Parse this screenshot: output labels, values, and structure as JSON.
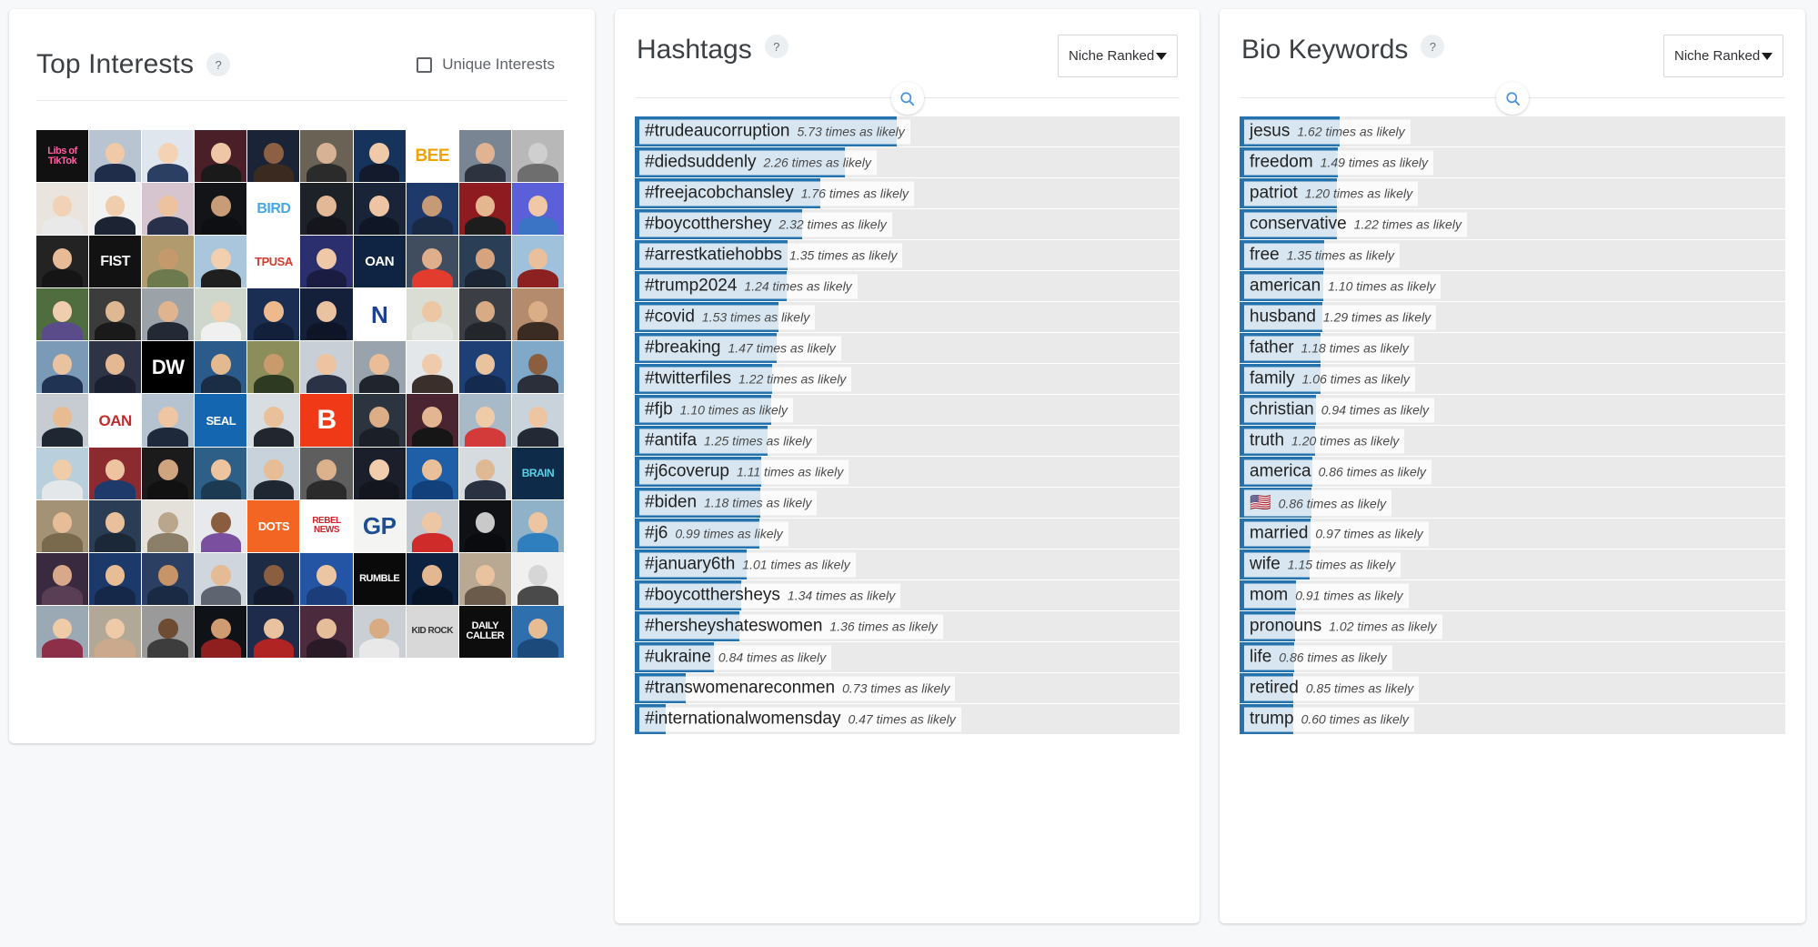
{
  "theme": {
    "bar_color": "#2573ae",
    "track_color": "#eaeaea",
    "page_bg": "#f7f8fa",
    "accent": "#4a90d9"
  },
  "interests_panel": {
    "title": "Top Interests",
    "help_label": "?",
    "checkbox_label": "Unique Interests",
    "checkbox_checked": false,
    "grid_rows": 10,
    "grid_cols": 10,
    "grid_tiles": [
      {
        "kind": "logo",
        "text": "Libs of TikTok",
        "bg": "#111111",
        "fg": "#ff5fa2",
        "fs": 11
      },
      {
        "kind": "photo",
        "bg": "#b9c4d2",
        "skin": "#f0c9a8",
        "suit": "#1f2d4a"
      },
      {
        "kind": "photo",
        "bg": "#dfe6ee",
        "skin": "#f3d3b3",
        "suit": "#2b3f63"
      },
      {
        "kind": "photo",
        "bg": "#4a1f28",
        "skin": "#efc6a6",
        "suit": "#1a1a1a"
      },
      {
        "kind": "photo",
        "bg": "#1b2436",
        "skin": "#8d5f43",
        "suit": "#3a2a20"
      },
      {
        "kind": "photo",
        "bg": "#6b6256",
        "skin": "#d8b294",
        "suit": "#2b2b2b"
      },
      {
        "kind": "photo",
        "bg": "#16335c",
        "skin": "#f0c9a8",
        "suit": "#121a2b"
      },
      {
        "kind": "logo",
        "text": "BEE",
        "bg": "#ffffff",
        "fg": "#f0a202",
        "fs": 19
      },
      {
        "kind": "photo",
        "bg": "#7a8594",
        "skin": "#e2b393",
        "suit": "#2d3440"
      },
      {
        "kind": "photo",
        "bg": "#b8b8b8",
        "skin": "#cfcfcf",
        "suit": "#6e6e6e"
      },
      {
        "kind": "photo",
        "bg": "#e9e4dd",
        "skin": "#f2d2b6",
        "suit": "#e9e9e9"
      },
      {
        "kind": "photo",
        "bg": "#f2f2f2",
        "skin": "#f0cdac",
        "suit": "#1c2433"
      },
      {
        "kind": "photo",
        "bg": "#d6c5cf",
        "skin": "#edc39f",
        "suit": "#29304a"
      },
      {
        "kind": "photo",
        "bg": "#121418",
        "skin": "#c89c78",
        "suit": "#0d0f13"
      },
      {
        "kind": "logo",
        "text": "BIRD",
        "bg": "#ffffff",
        "fg": "#4aa8e0",
        "fs": 16
      },
      {
        "kind": "photo",
        "bg": "#1d2128",
        "skin": "#e3b896",
        "suit": "#14161b"
      },
      {
        "kind": "photo",
        "bg": "#1a2438",
        "skin": "#eec5a4",
        "suit": "#0f1726"
      },
      {
        "kind": "photo",
        "bg": "#1d3a6b",
        "skin": "#c79a76",
        "suit": "#1b2a44"
      },
      {
        "kind": "photo",
        "bg": "#8e1b20",
        "skin": "#e5b791",
        "suit": "#1d1d1d"
      },
      {
        "kind": "photo",
        "bg": "#5b5fd8",
        "skin": "#f0c8a6",
        "suit": "#3b74c4"
      },
      {
        "kind": "photo",
        "bg": "#232323",
        "skin": "#e7bb96",
        "suit": "#151515"
      },
      {
        "kind": "logo",
        "text": "FIST",
        "bg": "#121212",
        "fg": "#f2f2f2",
        "fs": 16
      },
      {
        "kind": "photo",
        "bg": "#b19a6d",
        "skin": "#c49a6c",
        "suit": "#6c7a4d"
      },
      {
        "kind": "photo",
        "bg": "#a9c6dd",
        "skin": "#f2cfae",
        "suit": "#1f1f1f"
      },
      {
        "kind": "logo",
        "text": "TPUSA",
        "bg": "#ffffff",
        "fg": "#cf3b2d",
        "fs": 13
      },
      {
        "kind": "photo",
        "bg": "#2b2f6e",
        "skin": "#efc8a7",
        "suit": "#1a1c42"
      },
      {
        "kind": "logo",
        "text": "OAN",
        "bg": "#0f2342",
        "fg": "#ffffff",
        "fs": 15
      },
      {
        "kind": "photo",
        "bg": "#3f4d5e",
        "skin": "#dfae8a",
        "suit": "#e23c2f"
      },
      {
        "kind": "photo",
        "bg": "#2a3f55",
        "skin": "#d5a47e",
        "suit": "#1b2533"
      },
      {
        "kind": "photo",
        "bg": "#9fc1dc",
        "skin": "#e9bf9c",
        "suit": "#8d2020"
      },
      {
        "kind": "photo",
        "bg": "#4f6d3e",
        "skin": "#f1cdb0",
        "suit": "#5a4b8a"
      },
      {
        "kind": "photo",
        "bg": "#3c3c3c",
        "skin": "#dfb893",
        "suit": "#1a1a1a"
      },
      {
        "kind": "photo",
        "bg": "#9ba2a8",
        "skin": "#e0b48f",
        "suit": "#242a35"
      },
      {
        "kind": "photo",
        "bg": "#cfd6cb",
        "skin": "#f2d0b0",
        "suit": "#f0f0f0"
      },
      {
        "kind": "photo",
        "bg": "#1a2d52",
        "skin": "#edb98d",
        "suit": "#12203c"
      },
      {
        "kind": "photo",
        "bg": "#14203a",
        "skin": "#e9c2a0",
        "suit": "#0d1526"
      },
      {
        "kind": "logo",
        "text": "N",
        "bg": "#ffffff",
        "fg": "#1d3f94",
        "fs": 26
      },
      {
        "kind": "photo",
        "bg": "#d9ddd4",
        "skin": "#edc6a3",
        "suit": "#e3e6e0"
      },
      {
        "kind": "photo",
        "bg": "#3b3f45",
        "skin": "#d9ab85",
        "suit": "#23262b"
      },
      {
        "kind": "photo",
        "bg": "#b58b6d",
        "skin": "#dcae88",
        "suit": "#3a2c22"
      },
      {
        "kind": "photo",
        "bg": "#7b9ab8",
        "skin": "#e9c3a0",
        "suit": "#203352"
      },
      {
        "kind": "photo",
        "bg": "#2e3346",
        "skin": "#e3b893",
        "suit": "#1b2030"
      },
      {
        "kind": "logo",
        "text": "DW",
        "bg": "#000000",
        "fg": "#ffffff",
        "fs": 22
      },
      {
        "kind": "photo",
        "bg": "#2b5b8a",
        "skin": "#e5b98f",
        "suit": "#1a2d45"
      },
      {
        "kind": "photo",
        "bg": "#8b8e5a",
        "skin": "#c89a6c",
        "suit": "#2f3a23"
      },
      {
        "kind": "photo",
        "bg": "#c9cfd6",
        "skin": "#eec4a0",
        "suit": "#2a3246"
      },
      {
        "kind": "photo",
        "bg": "#99a3ad",
        "skin": "#e8bd97",
        "suit": "#1f242d"
      },
      {
        "kind": "photo",
        "bg": "#e3e7ea",
        "skin": "#f0cbab",
        "suit": "#3a2f2a"
      },
      {
        "kind": "photo",
        "bg": "#1d3f76",
        "skin": "#e9c39e",
        "suit": "#142a4f"
      },
      {
        "kind": "photo",
        "bg": "#7fa8c9",
        "skin": "#8a5e3f",
        "suit": "#2a2f3a"
      },
      {
        "kind": "photo",
        "bg": "#c6ccd2",
        "skin": "#e8bb93",
        "suit": "#1f2733"
      },
      {
        "kind": "logo",
        "text": "OAN",
        "bg": "#ffffff",
        "fg": "#c22c2c",
        "fs": 17
      },
      {
        "kind": "photo",
        "bg": "#b4c3cf",
        "skin": "#eec6a4",
        "suit": "#1e2a3c"
      },
      {
        "kind": "logo",
        "text": "SEAL",
        "bg": "#1566b0",
        "fg": "#ffffff",
        "fs": 13
      },
      {
        "kind": "photo",
        "bg": "#d8dde2",
        "skin": "#e9c09a",
        "suit": "#22272f"
      },
      {
        "kind": "logo",
        "text": "B",
        "bg": "#f03a17",
        "fg": "#ffffff",
        "fs": 30
      },
      {
        "kind": "photo",
        "bg": "#2c3440",
        "skin": "#dcae87",
        "suit": "#1a1f28"
      },
      {
        "kind": "photo",
        "bg": "#4a2430",
        "skin": "#e3b590",
        "suit": "#161616"
      },
      {
        "kind": "photo",
        "bg": "#a8b9c7",
        "skin": "#f0cba8",
        "suit": "#d33a3a"
      },
      {
        "kind": "photo",
        "bg": "#c9d3dc",
        "skin": "#eec5a2",
        "suit": "#232a36"
      },
      {
        "kind": "photo",
        "bg": "#b9cfdc",
        "skin": "#f0cda9",
        "suit": "#e4e7ea"
      },
      {
        "kind": "photo",
        "bg": "#8b2b2f",
        "skin": "#eec3a0",
        "suit": "#1d3a6b"
      },
      {
        "kind": "photo",
        "bg": "#1b1b1b",
        "skin": "#cfa57f",
        "suit": "#111111"
      },
      {
        "kind": "photo",
        "bg": "#2e5f86",
        "skin": "#eec49e",
        "suit": "#1c3a52"
      },
      {
        "kind": "photo",
        "bg": "#c7d2db",
        "skin": "#e7bd96",
        "suit": "#1f2733"
      },
      {
        "kind": "photo",
        "bg": "#5e5e5e",
        "skin": "#dcb28d",
        "suit": "#2b2b2b"
      },
      {
        "kind": "photo",
        "bg": "#1a1f2b",
        "skin": "#f1cdae",
        "suit": "#14161f"
      },
      {
        "kind": "photo",
        "bg": "#1f5fa8",
        "skin": "#e9c09a",
        "suit": "#12407a"
      },
      {
        "kind": "photo",
        "bg": "#d6dbe0",
        "skin": "#dfb894",
        "suit": "#2a3140"
      },
      {
        "kind": "logo",
        "text": "BRAIN",
        "bg": "#0f2b4a",
        "fg": "#5ad1e6",
        "fs": 12
      },
      {
        "kind": "photo",
        "bg": "#a39275",
        "skin": "#e6bd97",
        "suit": "#7a6a4d"
      },
      {
        "kind": "photo",
        "bg": "#2a3d55",
        "skin": "#e9c09c",
        "suit": "#1b2838"
      },
      {
        "kind": "photo",
        "bg": "#e4e1da",
        "skin": "#b9a68c",
        "suit": "#8c7f6a"
      },
      {
        "kind": "photo",
        "bg": "#e7e9ec",
        "skin": "#8a5d3e",
        "suit": "#7b4fa0"
      },
      {
        "kind": "logo",
        "text": "DOTS",
        "bg": "#f26522",
        "fg": "#ffffff",
        "fs": 13
      },
      {
        "kind": "logo",
        "text": "REBEL NEWS",
        "bg": "#ffffff",
        "fg": "#cc2229",
        "fs": 10
      },
      {
        "kind": "logo",
        "text": "GP",
        "bg": "#f4f4f2",
        "fg": "#1d4f91",
        "fs": 26
      },
      {
        "kind": "photo",
        "bg": "#c2c9d1",
        "skin": "#edc7a4",
        "suit": "#cf2b2b"
      },
      {
        "kind": "photo",
        "bg": "#0f1115",
        "skin": "#c9c9c9",
        "suit": "#0a0b0e"
      },
      {
        "kind": "photo",
        "bg": "#8fb2c9",
        "skin": "#eec5a1",
        "suit": "#2f7fbf"
      },
      {
        "kind": "photo",
        "bg": "#3a2a3f",
        "skin": "#d7a98a",
        "suit": "#5a3e55"
      },
      {
        "kind": "photo",
        "bg": "#1b3a6b",
        "skin": "#e8bd96",
        "suit": "#15284a"
      },
      {
        "kind": "photo",
        "bg": "#2b3f63",
        "skin": "#c79468",
        "suit": "#1a2a44"
      },
      {
        "kind": "photo",
        "bg": "#cfd6dd",
        "skin": "#e4bb95",
        "suit": "#5e6570"
      },
      {
        "kind": "photo",
        "bg": "#1d2b45",
        "skin": "#8a5e3f",
        "suit": "#121a2b"
      },
      {
        "kind": "photo",
        "bg": "#2455a4",
        "skin": "#ecc5a2",
        "suit": "#1b3e7a"
      },
      {
        "kind": "logo",
        "text": "RUMBLE",
        "bg": "#0a0a0a",
        "fg": "#ffffff",
        "fs": 11
      },
      {
        "kind": "photo",
        "bg": "#0d2240",
        "skin": "#e3b891",
        "suit": "#081528"
      },
      {
        "kind": "photo",
        "bg": "#b9a892",
        "skin": "#e9c2a0",
        "suit": "#6b5b4a"
      },
      {
        "kind": "photo",
        "bg": "#f0f0f0",
        "skin": "#d6d6d6",
        "suit": "#4a4a4a"
      },
      {
        "kind": "photo",
        "bg": "#9ba9b5",
        "skin": "#f0cba8",
        "suit": "#8e2f4a"
      },
      {
        "kind": "photo",
        "bg": "#b2a897",
        "skin": "#efcaa8",
        "suit": "#caa98c"
      },
      {
        "kind": "photo",
        "bg": "#9a9a9a",
        "skin": "#6e4b33",
        "suit": "#3d3d3d"
      },
      {
        "kind": "photo",
        "bg": "#0f1216",
        "skin": "#cf9b72",
        "suit": "#8f1f1f"
      },
      {
        "kind": "photo",
        "bg": "#1e2b4a",
        "skin": "#e9c39f",
        "suit": "#b02424"
      },
      {
        "kind": "photo",
        "bg": "#4a2a3c",
        "skin": "#e6bd99",
        "suit": "#2a1a26"
      },
      {
        "kind": "photo",
        "bg": "#c9cfd4",
        "skin": "#d9ab82",
        "suit": "#e8e8e8"
      },
      {
        "kind": "logo",
        "text": "KID ROCK",
        "bg": "#d8d8d8",
        "fg": "#333333",
        "fs": 10
      },
      {
        "kind": "logo",
        "text": "DAILY CALLER",
        "bg": "#0d0d0d",
        "fg": "#ffffff",
        "fs": 11
      },
      {
        "kind": "photo",
        "bg": "#2f6fae",
        "skin": "#e8bc93",
        "suit": "#1c4a7a"
      }
    ]
  },
  "hashtags_panel": {
    "title": "Hashtags",
    "help_label": "?",
    "sort_label": "Niche Ranked",
    "search_icon": "search-icon",
    "value_suffix": "times as likely",
    "max_bar_value": 5.73,
    "items": [
      {
        "term": "#trudeaucorruption",
        "value": "5.73",
        "bar_pct": 48.0
      },
      {
        "term": "#diedsuddenly",
        "value": "2.26",
        "bar_pct": 38.5
      },
      {
        "term": "#freejacobchansley",
        "value": "1.76",
        "bar_pct": 34.0
      },
      {
        "term": "#boycotthershey",
        "value": "2.32",
        "bar_pct": 30.8
      },
      {
        "term": "#arrestkatiehobbs",
        "value": "1.35",
        "bar_pct": 28.0
      },
      {
        "term": "#trump2024",
        "value": "1.24",
        "bar_pct": 27.8
      },
      {
        "term": "#covid",
        "value": "1.53",
        "bar_pct": 26.3
      },
      {
        "term": "#breaking",
        "value": "1.47",
        "bar_pct": 26.0
      },
      {
        "term": "#twitterfiles",
        "value": "1.22",
        "bar_pct": 25.2
      },
      {
        "term": "#fjb",
        "value": "1.10",
        "bar_pct": 25.0
      },
      {
        "term": "#antifa",
        "value": "1.25",
        "bar_pct": 24.3
      },
      {
        "term": "#j6coverup",
        "value": "1.11",
        "bar_pct": 23.2
      },
      {
        "term": "#biden",
        "value": "1.18",
        "bar_pct": 23.0
      },
      {
        "term": "#j6",
        "value": "0.99",
        "bar_pct": 22.8
      },
      {
        "term": "#january6th",
        "value": "1.01",
        "bar_pct": 20.5
      },
      {
        "term": "#boycotthersheys",
        "value": "1.34",
        "bar_pct": 19.6
      },
      {
        "term": "#hersheyshateswomen",
        "value": "1.36",
        "bar_pct": 19.2
      },
      {
        "term": "#ukraine",
        "value": "0.84",
        "bar_pct": 14.5
      },
      {
        "term": "#transwomenareconmen",
        "value": "0.73",
        "bar_pct": 9.4
      },
      {
        "term": "#internationalwomensday",
        "value": "0.47",
        "bar_pct": 5.6
      }
    ]
  },
  "bio_panel": {
    "title": "Bio Keywords",
    "help_label": "?",
    "sort_label": "Niche Ranked",
    "search_icon": "search-icon",
    "value_suffix": "times as likely",
    "max_bar_value": 1.62,
    "items": [
      {
        "term": "jesus",
        "value": "1.62",
        "bar_pct": 18.4
      },
      {
        "term": "freedom",
        "value": "1.49",
        "bar_pct": 18.0
      },
      {
        "term": "patriot",
        "value": "1.20",
        "bar_pct": 17.9
      },
      {
        "term": "conservative",
        "value": "1.22",
        "bar_pct": 17.8
      },
      {
        "term": "free",
        "value": "1.35",
        "bar_pct": 15.5
      },
      {
        "term": "american",
        "value": "1.10",
        "bar_pct": 15.4
      },
      {
        "term": "husband",
        "value": "1.29",
        "bar_pct": 15.2
      },
      {
        "term": "father",
        "value": "1.18",
        "bar_pct": 14.8
      },
      {
        "term": "family",
        "value": "1.06",
        "bar_pct": 14.8
      },
      {
        "term": "christian",
        "value": "0.94",
        "bar_pct": 14.0
      },
      {
        "term": "truth",
        "value": "1.20",
        "bar_pct": 13.8
      },
      {
        "term": "america",
        "value": "0.86",
        "bar_pct": 13.4
      },
      {
        "term": "🇺🇸",
        "value": "0.86",
        "bar_pct": 13.2,
        "is_emoji": true
      },
      {
        "term": "married",
        "value": "0.97",
        "bar_pct": 13.0
      },
      {
        "term": "wife",
        "value": "1.15",
        "bar_pct": 12.8
      },
      {
        "term": "mom",
        "value": "0.91",
        "bar_pct": 10.4
      },
      {
        "term": "pronouns",
        "value": "1.02",
        "bar_pct": 10.2
      },
      {
        "term": "life",
        "value": "0.86",
        "bar_pct": 10.0
      },
      {
        "term": "retired",
        "value": "0.85",
        "bar_pct": 9.9
      },
      {
        "term": "trump",
        "value": "0.60",
        "bar_pct": 9.8
      }
    ]
  }
}
